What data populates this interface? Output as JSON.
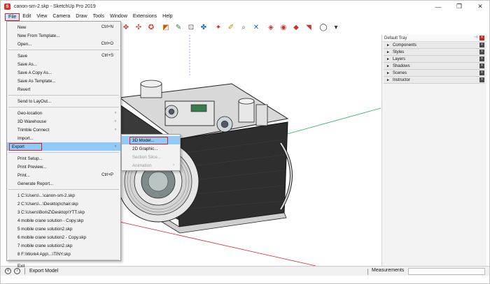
{
  "window": {
    "title": "canon-sm-2.skp - SketchUp Pro 2019",
    "minimize": "—",
    "maximize": "❐",
    "close": "✕"
  },
  "menubar": [
    "File",
    "Edit",
    "View",
    "Camera",
    "Draw",
    "Tools",
    "Window",
    "Extensions",
    "Help"
  ],
  "toolbar_icons": [
    {
      "name": "orbit-icon",
      "glyph": "✥",
      "color": "#c0392b"
    },
    {
      "name": "pan-icon",
      "glyph": "✣",
      "color": "#c0392b"
    },
    {
      "name": "zoom-extents-icon",
      "glyph": "✪",
      "color": "#c0392b"
    },
    {
      "name": "paint-bucket-icon",
      "glyph": "◩",
      "color": "#d35400"
    },
    {
      "name": "tape-measure-icon",
      "glyph": "✎",
      "color": "#2e7d32"
    },
    {
      "name": "text-icon",
      "glyph": "⊡",
      "color": "#555555"
    },
    {
      "name": "axes-icon",
      "glyph": "✤",
      "color": "#1565c0"
    },
    {
      "name": "position-camera-icon",
      "glyph": "✦",
      "color": "#c0392b"
    },
    {
      "name": "walk-icon",
      "glyph": "✐",
      "color": "#b8860b"
    },
    {
      "name": "look-around-icon",
      "glyph": "⌕",
      "color": "#555555"
    },
    {
      "name": "section-plane-icon",
      "glyph": "✕",
      "color": "#1565c0"
    },
    {
      "name": "warehouse-icon",
      "glyph": "◈",
      "color": "#c0392b"
    },
    {
      "name": "share-model-icon",
      "glyph": "◉",
      "color": "#c0392b"
    },
    {
      "name": "extension-warehouse-icon",
      "glyph": "◆",
      "color": "#c0392b"
    },
    {
      "name": "ruby-icon",
      "glyph": "◥",
      "color": "#c0392b"
    },
    {
      "name": "account-icon",
      "glyph": "◯",
      "color": "#333333"
    },
    {
      "name": "account-dropdown-icon",
      "glyph": "▾",
      "color": "#333333"
    }
  ],
  "file_menu": {
    "groups": [
      [
        {
          "label": "New",
          "shortcut": "Ctrl+N"
        },
        {
          "label": "New From Template...",
          "shortcut": ""
        },
        {
          "label": "Open...",
          "shortcut": "Ctrl+O"
        }
      ],
      [
        {
          "label": "Save",
          "shortcut": "Ctrl+S"
        },
        {
          "label": "Save As...",
          "shortcut": ""
        },
        {
          "label": "Save A Copy As...",
          "shortcut": ""
        },
        {
          "label": "Save As Template...",
          "shortcut": ""
        },
        {
          "label": "Revert",
          "shortcut": ""
        }
      ],
      [
        {
          "label": "Send to LayOut...",
          "shortcut": ""
        }
      ],
      [
        {
          "label": "Geo-location",
          "shortcut": "",
          "submenu": true
        },
        {
          "label": "3D Warehouse",
          "shortcut": "",
          "submenu": true
        },
        {
          "label": "Trimble Connect",
          "shortcut": "",
          "submenu": true
        },
        {
          "label": "Import...",
          "shortcut": ""
        },
        {
          "label": "Export",
          "shortcut": "",
          "submenu": true,
          "highlighted": true
        }
      ],
      [
        {
          "label": "Print Setup...",
          "shortcut": ""
        },
        {
          "label": "Print Preview...",
          "shortcut": ""
        },
        {
          "label": "Print...",
          "shortcut": "Ctrl+P"
        },
        {
          "label": "Generate Report...",
          "shortcut": ""
        }
      ],
      [
        {
          "label": "1 C:\\Users\\...\\canon-sm-2.skp",
          "shortcut": ""
        },
        {
          "label": "2 C:\\Users\\...\\Desktop\\chair.skp",
          "shortcut": ""
        },
        {
          "label": "3 C:\\Users\\BomZ\\Desktop\\YTT.skp",
          "shortcut": ""
        },
        {
          "label": "4 mobile crane solution - Copy.skp",
          "shortcut": ""
        },
        {
          "label": "5 mobile crane solution2.skp",
          "shortcut": ""
        },
        {
          "label": "6 mobile crane solution2 - Copy.skp",
          "shortcut": ""
        },
        {
          "label": "7 mobile crane solution2.skp",
          "shortcut": ""
        },
        {
          "label": "8 F:\\Work4 App\\...\\TINY.skp",
          "shortcut": ""
        }
      ],
      [
        {
          "label": "Exit",
          "shortcut": ""
        }
      ]
    ]
  },
  "export_submenu": [
    {
      "label": "3D Model...",
      "highlighted": true,
      "disabled": false
    },
    {
      "label": "2D Graphic...",
      "highlighted": false,
      "disabled": false
    },
    {
      "label": "Section Slice...",
      "highlighted": false,
      "disabled": true
    },
    {
      "label": "Animation",
      "highlighted": false,
      "disabled": true,
      "submenu": true
    }
  ],
  "tray": {
    "title": "Default Tray",
    "panels": [
      "Components",
      "Styles",
      "Layers",
      "Shadows",
      "Scenes",
      "Instructor"
    ]
  },
  "statusbar": {
    "text": "Export Model",
    "measurements_label": "Measurements",
    "measurements_value": ""
  },
  "colors": {
    "highlight_border": "#d42222",
    "menu_highlight": "#91c9f7",
    "axis_green": "#22b14c",
    "axis_red": "#d42222"
  }
}
